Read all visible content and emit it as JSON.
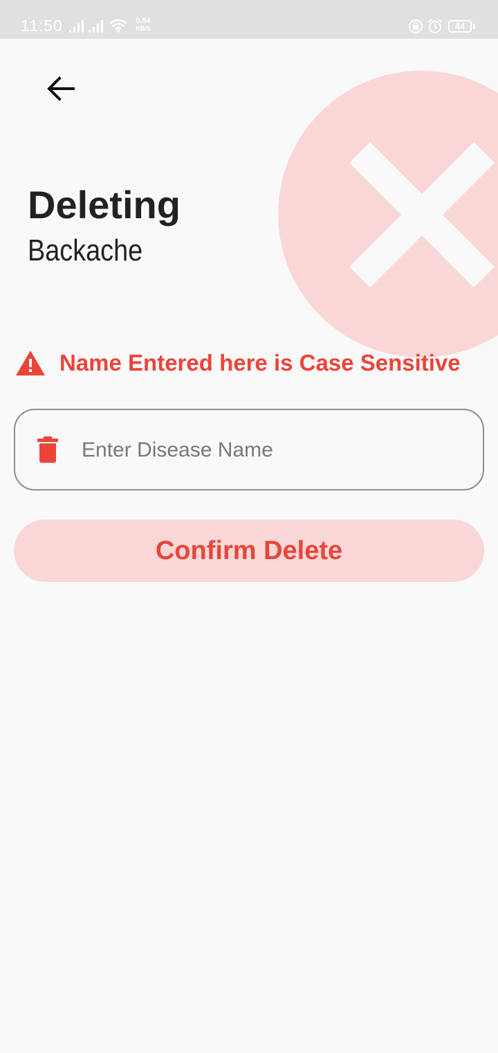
{
  "status_bar": {
    "time": "11:50",
    "net_speed_value": "0.54",
    "net_speed_unit": "KB/S",
    "battery": "44",
    "icons": [
      "signal-icon",
      "signal-icon",
      "wifi-icon",
      "rotation-lock-icon",
      "alarm-icon",
      "battery-icon"
    ]
  },
  "header": {
    "back_icon": "arrow-left-icon",
    "title": "Deleting",
    "subtitle": "Backache"
  },
  "decoration": {
    "icon": "close-icon",
    "circle_color": "#f9d7d7",
    "x_color": "#f9f9fa"
  },
  "warning": {
    "icon": "warning-triangle-icon",
    "text": "Name Entered here is Case Sensitive",
    "color": "#ec4438"
  },
  "form": {
    "input_icon": "trash-icon",
    "input_placeholder": "Enter Disease Name",
    "input_value": "",
    "confirm_label": "Confirm Delete"
  },
  "colors": {
    "accent": "#e8453c",
    "accent_light": "#f9d7d7",
    "background": "#f9f9fa",
    "text": "#222222"
  }
}
